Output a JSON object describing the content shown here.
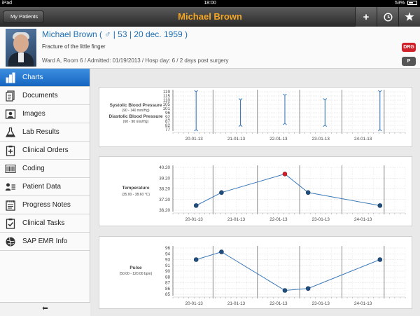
{
  "status_bar": {
    "device": "iPad",
    "time": "18:00",
    "battery": "53%"
  },
  "nav": {
    "back_label": "My Patients",
    "title": "Michael Brown",
    "actions": [
      {
        "icon": "plus-icon",
        "glyph": "+"
      },
      {
        "icon": "clock-icon",
        "glyph": "◷"
      },
      {
        "icon": "star-icon",
        "glyph": "★"
      }
    ]
  },
  "patient": {
    "name_line": "Michael Brown ( ♂ | 53 | 20 dec. 1959 )",
    "diagnosis": "Fracture of the little finger",
    "ward_line": "Ward A, Room 6 / Admitted: 01/19/2013 / Hosp day: 6 / 2 days post surgery",
    "badges": {
      "drg": "DRG",
      "p": "P"
    }
  },
  "sidebar": {
    "items": [
      {
        "label": "Charts",
        "icon": "bar-chart-icon",
        "active": true
      },
      {
        "label": "Documents",
        "icon": "documents-icon",
        "active": false
      },
      {
        "label": "Images",
        "icon": "images-icon",
        "active": false
      },
      {
        "label": "Lab Results",
        "icon": "flask-icon",
        "active": false
      },
      {
        "label": "Clinical Orders",
        "icon": "clipboard-plus-icon",
        "active": false
      },
      {
        "label": "Coding",
        "icon": "barcode-icon",
        "active": false
      },
      {
        "label": "Patient Data",
        "icon": "patient-data-icon",
        "active": false
      },
      {
        "label": "Progress Notes",
        "icon": "notes-icon",
        "active": false
      },
      {
        "label": "Clinical Tasks",
        "icon": "tasks-icon",
        "active": false
      },
      {
        "label": "SAP EMR Info",
        "icon": "sap-globe-icon",
        "active": false
      }
    ],
    "footer_icon": "back-arrow-icon",
    "footer_glyph": "⬅"
  },
  "colors": {
    "accent": "#f5a623",
    "active_blue": "#1a6dc7",
    "line": "#3a78b8",
    "point": "#1f4e80",
    "alert": "#d0202a"
  },
  "chart_data": [
    {
      "type": "range",
      "labels": [
        "Systolic Blood Pressure",
        "(90 - 140 mm/Hg)",
        "Diastolic Blood Pressure",
        "(60 - 90 mm/Hg)"
      ],
      "y_ticks": [
        "119",
        "115",
        "110",
        "105",
        "101",
        "96",
        "92",
        "87",
        "82",
        "77"
      ],
      "ylim": [
        77,
        119
      ],
      "x_ticks": [
        "20-01-13",
        "21-01-13",
        "22-01-13",
        "23-01-13",
        "24-01-13"
      ],
      "xlim": [
        0,
        5.5
      ],
      "series": [
        {
          "x": 0.55,
          "low": 77,
          "high": 119
        },
        {
          "x": 1.6,
          "low": 82,
          "high": 110
        },
        {
          "x": 2.65,
          "low": 84,
          "high": 115
        },
        {
          "x": 3.6,
          "low": 82,
          "high": 110
        },
        {
          "x": 4.9,
          "low": 77,
          "high": 119
        }
      ],
      "day_dividers": [
        0.95,
        2.0,
        3.0,
        4.0,
        5.0
      ]
    },
    {
      "type": "line",
      "labels": [
        "Temperature",
        "(35.00 - 38.60 °C)"
      ],
      "y_ticks": [
        "40.20",
        "39.20",
        "38.20",
        "37.20",
        "36.20"
      ],
      "ylim": [
        35.7,
        40.3
      ],
      "x_ticks": [
        "20-01-13",
        "21-01-13",
        "22-01-13",
        "23-01-13",
        "24-01-13"
      ],
      "xlim": [
        0,
        5.5
      ],
      "points": [
        {
          "x": 0.55,
          "y": 36.2,
          "alert": false
        },
        {
          "x": 1.15,
          "y": 37.6,
          "alert": false
        },
        {
          "x": 2.65,
          "y": 39.6,
          "alert": true
        },
        {
          "x": 3.2,
          "y": 37.6,
          "alert": false
        },
        {
          "x": 4.9,
          "y": 36.2,
          "alert": false
        }
      ],
      "day_dividers": [
        0.95,
        2.0,
        3.0,
        4.0,
        5.0
      ]
    },
    {
      "type": "line",
      "labels": [
        "Pulse",
        "(50.00 - 120.00 bpm)"
      ],
      "y_ticks": [
        "96",
        "94",
        "93",
        "91",
        "90",
        "88",
        "87",
        "86",
        "85"
      ],
      "ylim": [
        84,
        96
      ],
      "x_ticks": [
        "20-01-13",
        "21-01-13",
        "22-01-13",
        "23-01-13",
        "24-01-13"
      ],
      "xlim": [
        0,
        5.5
      ],
      "points": [
        {
          "x": 0.55,
          "y": 93,
          "alert": false
        },
        {
          "x": 1.15,
          "y": 95,
          "alert": false
        },
        {
          "x": 2.65,
          "y": 85,
          "alert": false
        },
        {
          "x": 3.2,
          "y": 85.5,
          "alert": false
        },
        {
          "x": 4.9,
          "y": 93,
          "alert": false
        }
      ],
      "day_dividers": [
        0.95,
        2.0,
        3.0,
        4.0,
        5.0
      ]
    }
  ]
}
